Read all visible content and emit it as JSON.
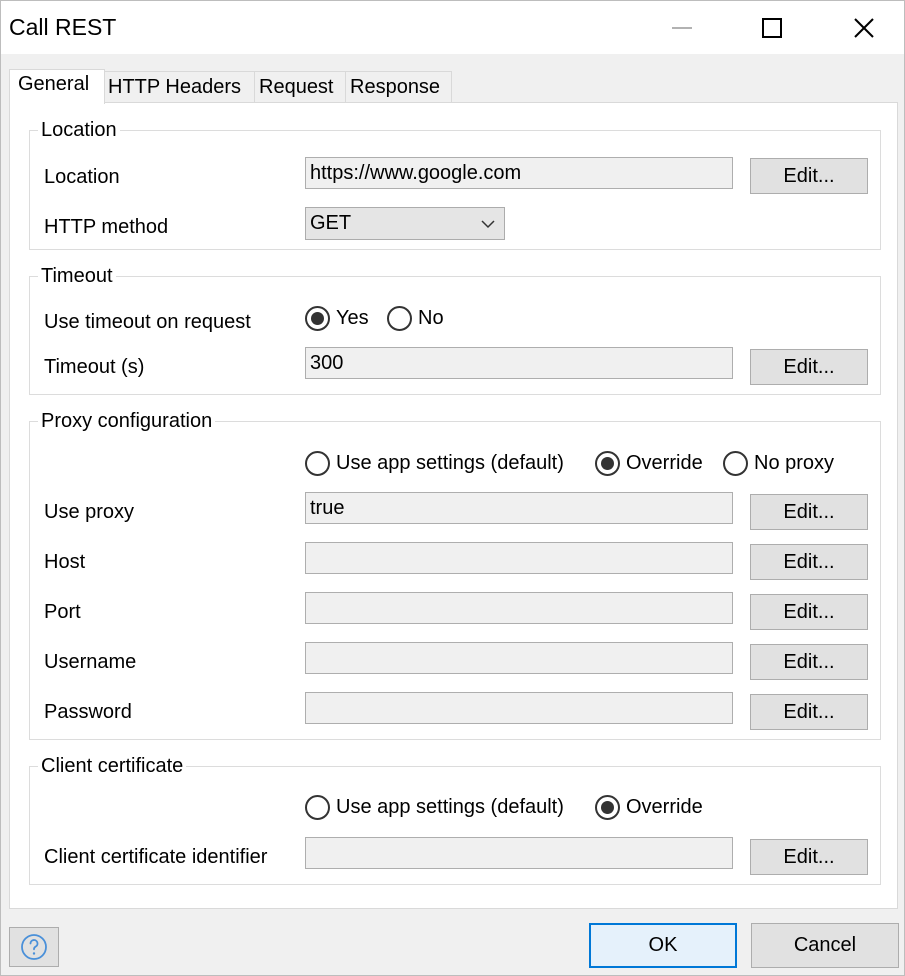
{
  "window": {
    "title": "Call REST"
  },
  "tabs": [
    {
      "label": "General",
      "active": true
    },
    {
      "label": "HTTP Headers",
      "active": false
    },
    {
      "label": "Request",
      "active": false
    },
    {
      "label": "Response",
      "active": false
    }
  ],
  "location_group": {
    "title": "Location",
    "location_label": "Location",
    "location_value": "https://www.google.com",
    "method_label": "HTTP method",
    "method_value": "GET",
    "edit_label": "Edit..."
  },
  "timeout_group": {
    "title": "Timeout",
    "use_timeout_label": "Use timeout on request",
    "yes_label": "Yes",
    "no_label": "No",
    "selected": "Yes",
    "timeout_label": "Timeout (s)",
    "timeout_value": "300",
    "edit_label": "Edit..."
  },
  "proxy_group": {
    "title": "Proxy configuration",
    "option_app": "Use app settings (default)",
    "option_override": "Override",
    "option_none": "No proxy",
    "selected": "Override",
    "use_proxy_label": "Use proxy",
    "use_proxy_value": "true",
    "host_label": "Host",
    "host_value": "",
    "port_label": "Port",
    "port_value": "",
    "username_label": "Username",
    "username_value": "",
    "password_label": "Password",
    "password_value": "",
    "edit_label": "Edit..."
  },
  "cert_group": {
    "title": "Client certificate",
    "option_app": "Use app settings (default)",
    "option_override": "Override",
    "selected": "Override",
    "identifier_label": "Client certificate identifier",
    "identifier_value": "",
    "edit_label": "Edit..."
  },
  "footer": {
    "ok_label": "OK",
    "cancel_label": "Cancel",
    "help_icon": "help-circle-icon"
  }
}
